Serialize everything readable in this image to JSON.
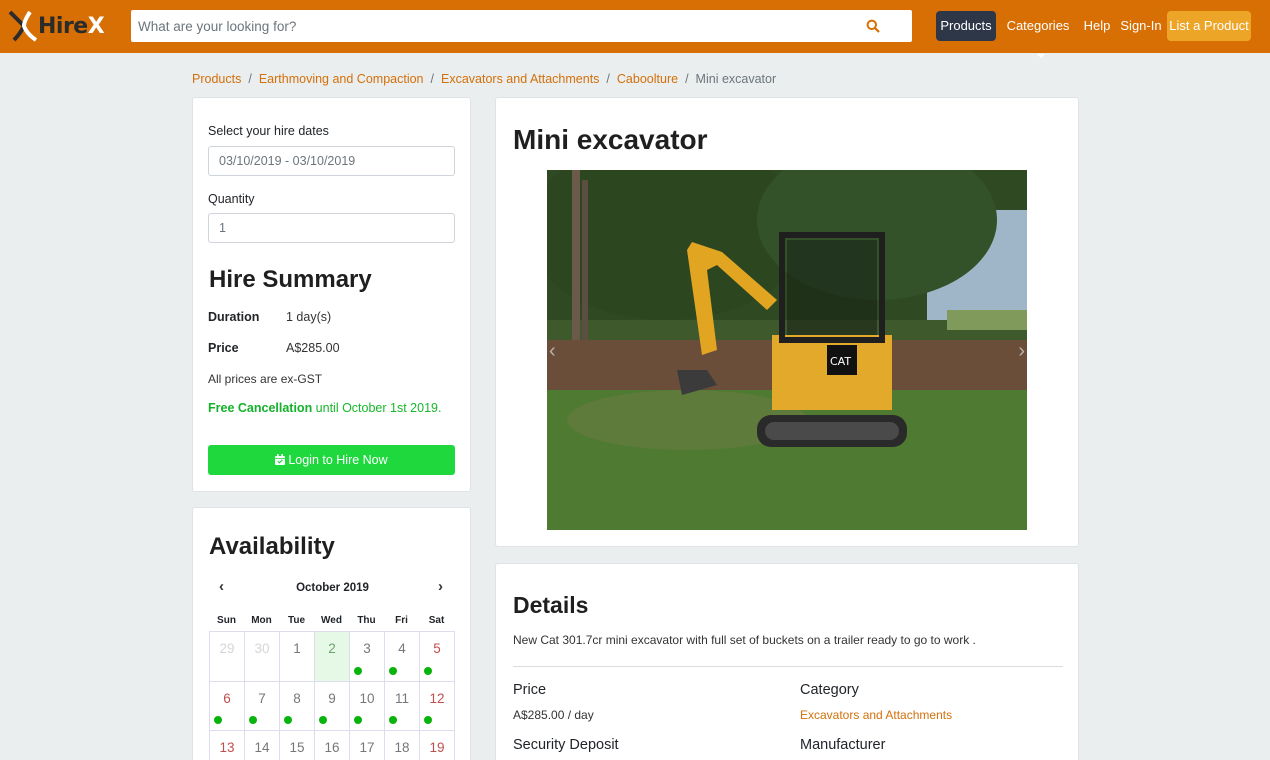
{
  "navbar": {
    "brand_a": "Hire",
    "brand_b": "X",
    "search_placeholder": "What are your looking for?",
    "items": {
      "products": "Products",
      "categories": "Categories",
      "help": "Help",
      "signin": "Sign-In",
      "list": "List a Product"
    },
    "colors": {
      "bar": "#d86f05",
      "products_btn": "#2d3748",
      "list_btn": "#eda528"
    }
  },
  "breadcrumb": [
    "Products",
    "Earthmoving and Compaction",
    "Excavators and Attachments",
    "Caboolture",
    "Mini excavator"
  ],
  "hire": {
    "dates_label": "Select your hire dates",
    "dates_value": "03/10/2019 - 03/10/2019",
    "quantity_label": "Quantity",
    "quantity_value": "1",
    "summary_title": "Hire Summary",
    "duration_label": "Duration",
    "duration_value": "1 day(s)",
    "price_label": "Price",
    "price_value": "A$285.00",
    "gst_note": "All prices are ex-GST",
    "cancel_strong": "Free Cancellation",
    "cancel_rest": " until October 1st 2019.",
    "button": "Login to Hire Now"
  },
  "availability": {
    "title": "Availability",
    "prev": "‹",
    "next": "›",
    "month": "October 2019",
    "weekdays": [
      "Sun",
      "Mon",
      "Tue",
      "Wed",
      "Thu",
      "Fri",
      "Sat"
    ],
    "weeks": [
      [
        "29",
        "30",
        "1",
        "2",
        "3",
        "4",
        "5"
      ],
      [
        "6",
        "7",
        "8",
        "9",
        "10",
        "11",
        "12"
      ],
      [
        "13",
        "14",
        "15",
        "16",
        "17",
        "18",
        "19"
      ]
    ]
  },
  "product": {
    "title": "Mini excavator",
    "image_alt_icon": "excavator-photo"
  },
  "details": {
    "title": "Details",
    "description": "New Cat 301.7cr mini excavator with full set of buckets on a trailer ready to go to work .",
    "price_label": "Price",
    "price_value": "A$285.00 / day",
    "category_label": "Category",
    "category_value": "Excavators and Attachments",
    "deposit_label": "Security Deposit",
    "manufacturer_label": "Manufacturer"
  }
}
